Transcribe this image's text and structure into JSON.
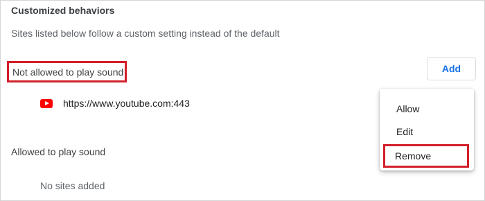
{
  "section": {
    "title": "Customized behaviors",
    "subtitle": "Sites listed below follow a custom setting instead of the default"
  },
  "blocked": {
    "header": "Not allowed to play sound",
    "add_label": "Add",
    "sites": [
      {
        "url": "https://www.youtube.com:443",
        "icon": "youtube-icon"
      }
    ]
  },
  "allowed": {
    "header": "Allowed to play sound",
    "empty_text": "No sites added"
  },
  "context_menu": {
    "items": [
      "Allow",
      "Edit",
      "Remove"
    ]
  },
  "colors": {
    "highlight": "#d21f2a",
    "accent": "#1a73e8",
    "youtube": "#ff0000"
  }
}
